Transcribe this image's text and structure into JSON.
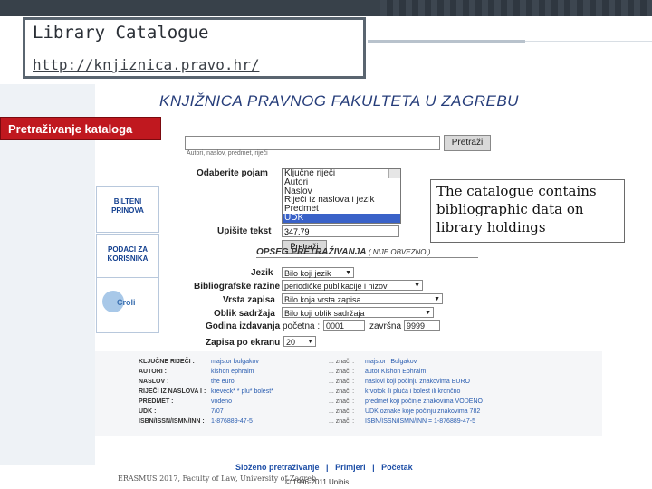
{
  "slide": {
    "title": "Library Catalogue",
    "url": "http://knjiznica.pravo.hr/",
    "callout": "The catalogue contains bibliographic data on library holdings",
    "footer": "ERASMUS 2017, Faculty of Law, University of Zagreb"
  },
  "site": {
    "header": "KNJIŽNICA PRAVNOG FAKULTETA U ZAGREBU",
    "search_catalog_label": "Pretraživanje kataloga",
    "search_button": "Pretraži",
    "search_hint": "Autori, naslov, predmet, riječi",
    "choose_term_label": "Odaberite pojam",
    "term_options": [
      "Ključne riječi",
      "Autori",
      "Naslov",
      "Riječi iz naslova i jezik",
      "Predmet",
      "UDK"
    ],
    "selected_term": "UDK",
    "enter_text_label": "Upišite tekst",
    "enter_text_value": "347.79",
    "search_button_2": "Pretraži",
    "sidebar": [
      {
        "label": "BILTENI PRINOVA"
      },
      {
        "label": "PODACI ZA KORISNIKA"
      }
    ],
    "logo_text": "Croli",
    "scope_title": "OPSEG PRETRAŽIVANJA",
    "scope_note": "( NIJE OBVEZNO )",
    "filters": [
      {
        "label": "Jezik",
        "value": "Bilo koji jezik"
      },
      {
        "label": "Bibliografske razine",
        "value": "periodičke publikacije i nizovi"
      },
      {
        "label": "Vrsta zapisa",
        "value": "Bilo koja vrsta zapisa"
      },
      {
        "label": "Oblik sadržaja",
        "value": "Bilo koji oblik sadržaja"
      }
    ],
    "year_label": "Godina izdavanja",
    "year_start_label": "početna :",
    "year_start": "0001",
    "year_end_label": "završna :",
    "year_end": "9999",
    "records_label": "Zapisa po ekranu",
    "records_value": "20",
    "results": [
      {
        "key": "KLJUČNE RIJEČI :",
        "value": "majstor bulgakov",
        "znaci": "... znači :",
        "desc": "majstor i Bulgakov"
      },
      {
        "key": "AUTORI :",
        "value": "kishon ephraim",
        "znaci": "... znači :",
        "desc": "autor Kishon Ephraim"
      },
      {
        "key": "NASLOV :",
        "value": "the euro",
        "znaci": "... znači :",
        "desc": "naslovi koji počinju znakovima EURO"
      },
      {
        "key": "RIJEČI IZ NASLOVA I :",
        "value": "kreveck* * plu* bolest*",
        "znaci": "... znači :",
        "desc": "krvotok ili pluća i bolest ili krončno"
      },
      {
        "key": "PREDMET :",
        "value": "vodeno",
        "znaci": "... znači :",
        "desc": "predmet koji počinje znakovima VODENO"
      },
      {
        "key": "UDK :",
        "value": "7/07",
        "znaci": "... znači :",
        "desc": "UDK oznake koje počinju znakovima 782"
      },
      {
        "key": "ISBN/ISSN/ISMN/INN :",
        "value": "1-876889-47-5",
        "znaci": "... znači :",
        "desc": "ISBN/ISSN/ISMN/INN = 1-876889-47-5"
      }
    ],
    "footer_links": [
      "Složeno pretraživanje",
      "Primjeri",
      "Početak"
    ],
    "copyright": "© 1996-2011 Unibis"
  }
}
